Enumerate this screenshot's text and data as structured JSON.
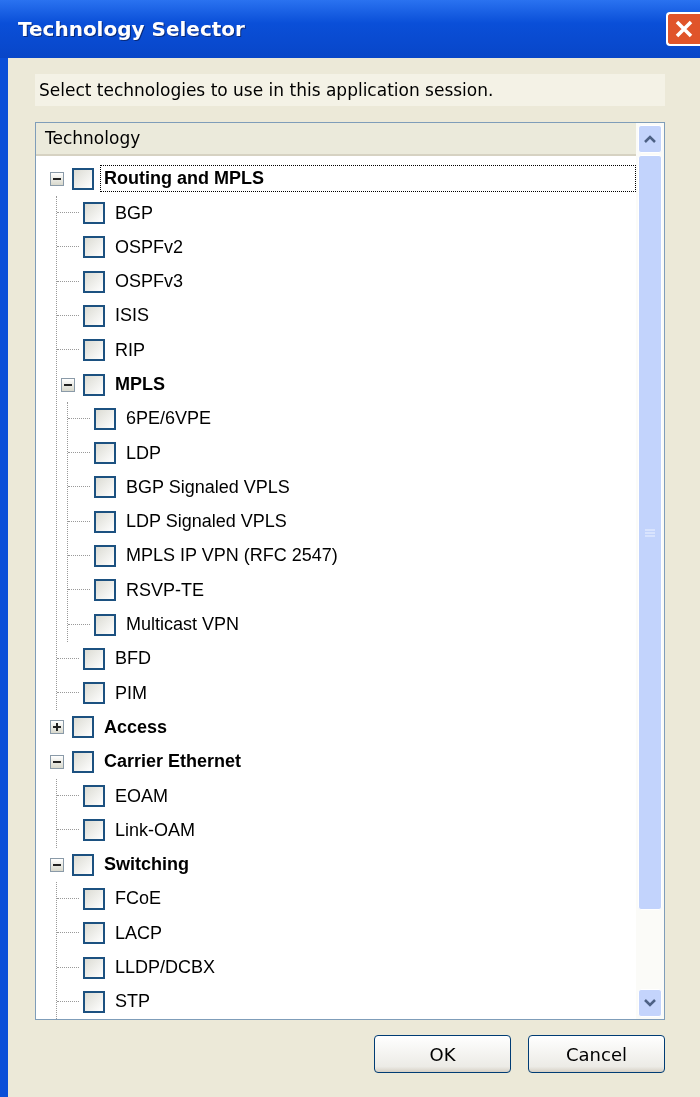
{
  "window": {
    "title": "Technology Selector"
  },
  "instruction": "Select technologies to use in this application session.",
  "tree": {
    "column": "Technology",
    "items": [
      {
        "label": "Routing and MPLS",
        "kind": "group",
        "checked": false,
        "expanded": true,
        "selected": true,
        "children": [
          {
            "label": "BGP",
            "kind": "item",
            "checked": false,
            "selected": false
          },
          {
            "label": "OSPFv2",
            "kind": "item",
            "checked": false,
            "selected": false
          },
          {
            "label": "OSPFv3",
            "kind": "item",
            "checked": false,
            "selected": false
          },
          {
            "label": "ISIS",
            "kind": "item",
            "checked": false,
            "selected": false
          },
          {
            "label": "RIP",
            "kind": "item",
            "checked": false,
            "selected": false
          },
          {
            "label": "MPLS",
            "kind": "group",
            "checked": false,
            "expanded": true,
            "selected": false,
            "children": [
              {
                "label": "6PE/6VPE",
                "kind": "item",
                "checked": false,
                "selected": false
              },
              {
                "label": "LDP",
                "kind": "item",
                "checked": false,
                "selected": false
              },
              {
                "label": "BGP Signaled VPLS",
                "kind": "item",
                "checked": false,
                "selected": false
              },
              {
                "label": "LDP Signaled VPLS",
                "kind": "item",
                "checked": false,
                "selected": false
              },
              {
                "label": "MPLS IP VPN (RFC 2547)",
                "kind": "item",
                "checked": false,
                "selected": false
              },
              {
                "label": "RSVP-TE",
                "kind": "item",
                "checked": false,
                "selected": false
              },
              {
                "label": "Multicast VPN",
                "kind": "item",
                "checked": false,
                "selected": false
              }
            ]
          },
          {
            "label": "BFD",
            "kind": "item",
            "checked": false,
            "selected": false
          },
          {
            "label": "PIM",
            "kind": "item",
            "checked": false,
            "selected": false
          }
        ]
      },
      {
        "label": "Access",
        "kind": "group",
        "checked": false,
        "expanded": false,
        "selected": false
      },
      {
        "label": "Carrier Ethernet",
        "kind": "group",
        "checked": false,
        "expanded": true,
        "selected": false,
        "children": [
          {
            "label": "EOAM",
            "kind": "item",
            "checked": false,
            "selected": false
          },
          {
            "label": "Link-OAM",
            "kind": "item",
            "checked": false,
            "selected": false
          }
        ]
      },
      {
        "label": "Switching",
        "kind": "group",
        "checked": false,
        "expanded": true,
        "selected": false,
        "children": [
          {
            "label": "FCoE",
            "kind": "item",
            "checked": false,
            "selected": false
          },
          {
            "label": "LACP",
            "kind": "item",
            "checked": false,
            "selected": false
          },
          {
            "label": "LLDP/DCBX",
            "kind": "item",
            "checked": false,
            "selected": false
          },
          {
            "label": "STP",
            "kind": "item",
            "checked": false,
            "selected": false
          }
        ]
      }
    ]
  },
  "buttons": [
    "OK",
    "Cancel"
  ]
}
